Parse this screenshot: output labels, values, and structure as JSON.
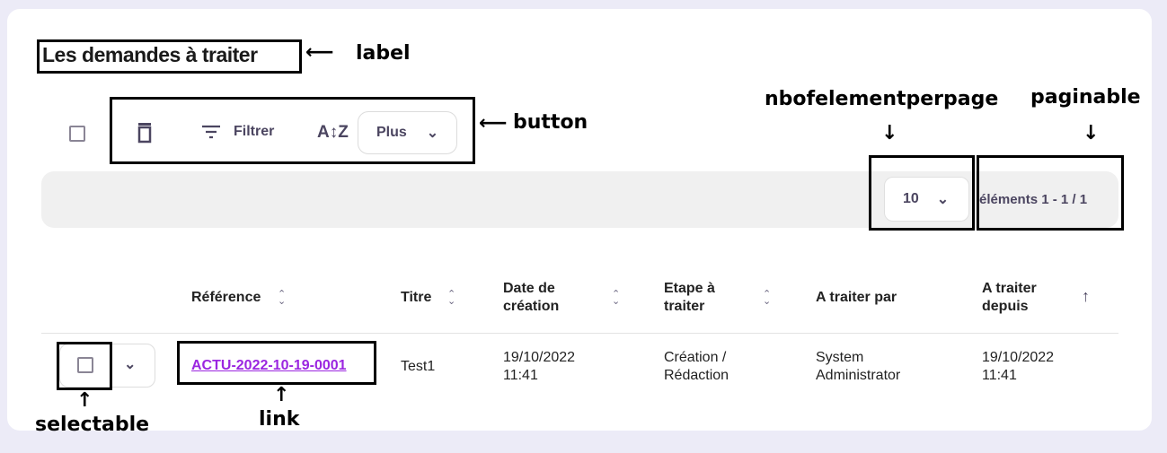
{
  "page": {
    "title": "Les demandes à traiter"
  },
  "toolbar": {
    "delete_icon": "trash-icon",
    "filter_label": "Filtrer",
    "sort_icon": "sort-az-icon",
    "more_label": "Plus"
  },
  "pagination": {
    "per_page": "10",
    "range_label": "éléments 1 - 1 / 1"
  },
  "table": {
    "columns": [
      {
        "label": "Référence",
        "sort": "both"
      },
      {
        "label": "Titre",
        "sort": "both"
      },
      {
        "label": "Date de création",
        "sort": "both"
      },
      {
        "label": "Etape à traiter",
        "sort": "both"
      },
      {
        "label": "A traiter par",
        "sort": "none"
      },
      {
        "label": "A traiter depuis",
        "sort": "asc"
      }
    ],
    "rows": [
      {
        "reference": "ACTU-2022-10-19-0001",
        "titre": "Test1",
        "date_creation": "19/10/2022 11:41",
        "etape": "Création / Rédaction",
        "traiter_par": "System Administrator",
        "depuis": "19/10/2022 11:41"
      }
    ]
  },
  "annotations": {
    "label": "label",
    "button": "button",
    "nbofelementperpage": "nbofelementperpage",
    "paginable": "paginable",
    "selectable": "selectable",
    "link": "link"
  },
  "colors": {
    "link": "#9b26e0",
    "background": "#ecebf7",
    "toolbar_text": "#4b4560"
  }
}
